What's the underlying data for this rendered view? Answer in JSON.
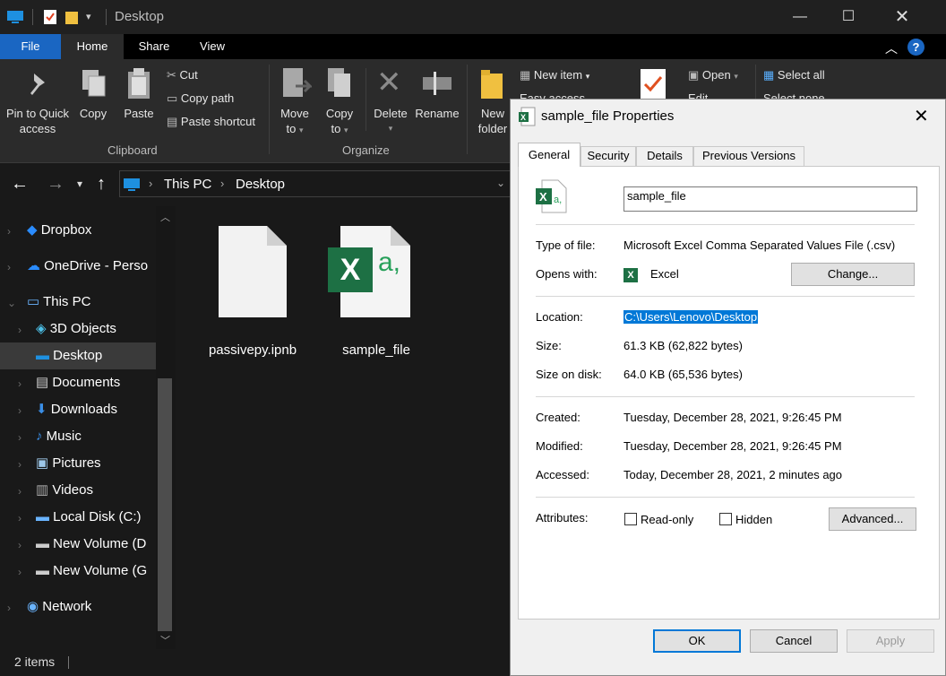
{
  "window": {
    "title": "Desktop"
  },
  "menubar": {
    "file": "File",
    "home": "Home",
    "share": "Share",
    "view": "View"
  },
  "ribbon": {
    "pin_label_1": "Pin to Quick",
    "pin_label_2": "access",
    "copy": "Copy",
    "paste": "Paste",
    "cut": "Cut",
    "copy_path": "Copy path",
    "paste_shortcut": "Paste shortcut",
    "clipboard_group": "Clipboard",
    "move_to_1": "Move",
    "move_to_2": "to",
    "copy_to_1": "Copy",
    "copy_to_2": "to",
    "delete": "Delete",
    "rename": "Rename",
    "organize_group": "Organize",
    "new_folder_1": "New",
    "new_folder_2": "folder",
    "new_item": "New item",
    "easy_access": "Easy access",
    "open": "Open",
    "edit": "Edit",
    "select_all": "Select all",
    "select_none": "Select none"
  },
  "address": {
    "crumb1": "This PC",
    "crumb2": "Desktop"
  },
  "navpane": {
    "items": [
      {
        "label": "Dropbox"
      },
      {
        "label": "OneDrive - Perso"
      },
      {
        "label": "This PC"
      },
      {
        "label": "3D Objects"
      },
      {
        "label": "Desktop"
      },
      {
        "label": "Documents"
      },
      {
        "label": "Downloads"
      },
      {
        "label": "Music"
      },
      {
        "label": "Pictures"
      },
      {
        "label": "Videos"
      },
      {
        "label": "Local Disk (C:)"
      },
      {
        "label": "New Volume (D"
      },
      {
        "label": "New Volume (G"
      },
      {
        "label": "Network"
      }
    ]
  },
  "files": [
    {
      "name": "passivepy.ipnb"
    },
    {
      "name": "sample_file"
    }
  ],
  "status": {
    "count": "2 items"
  },
  "dialog": {
    "title": "sample_file Properties",
    "tabs": [
      "General",
      "Security",
      "Details",
      "Previous Versions"
    ],
    "filename": "sample_file",
    "type_label": "Type of file:",
    "type_value": "Microsoft Excel Comma Separated Values File (.csv)",
    "opens_label": "Opens with:",
    "opens_value": "Excel",
    "change_button": "Change...",
    "location_label": "Location:",
    "location_value": "C:\\Users\\Lenovo\\Desktop",
    "size_label": "Size:",
    "size_value": "61.3 KB (62,822 bytes)",
    "size_disk_label": "Size on disk:",
    "size_disk_value": "64.0 KB (65,536 bytes)",
    "created_label": "Created:",
    "created_value": "Tuesday, December 28, 2021, 9:26:45 PM",
    "modified_label": "Modified:",
    "modified_value": "Tuesday, December 28, 2021, 9:26:45 PM",
    "accessed_label": "Accessed:",
    "accessed_value": "Today, December 28, 2021, 2 minutes ago",
    "attributes_label": "Attributes:",
    "readonly_label": "Read-only",
    "hidden_label": "Hidden",
    "advanced_button": "Advanced...",
    "ok": "OK",
    "cancel": "Cancel",
    "apply": "Apply"
  },
  "colors": {
    "accent": "#0078d7",
    "excel_green": "#1d7044",
    "dark_bg": "#191919"
  }
}
